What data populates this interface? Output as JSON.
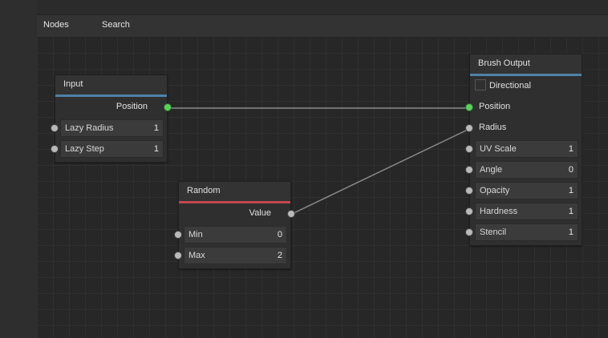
{
  "menu": {
    "nodes_label": "Nodes",
    "search_label": "Search"
  },
  "nodes": {
    "input": {
      "title": "Input",
      "output_label": "Position",
      "fields": [
        {
          "label": "Lazy Radius",
          "value": "1"
        },
        {
          "label": "Lazy Step",
          "value": "1"
        }
      ]
    },
    "random": {
      "title": "Random",
      "output_label": "Value",
      "fields": [
        {
          "label": "Min",
          "value": "0"
        },
        {
          "label": "Max",
          "value": "2"
        }
      ]
    },
    "brush_output": {
      "title": "Brush Output",
      "checkbox_label": "Directional",
      "position_label": "Position",
      "radius_label": "Radius",
      "fields": [
        {
          "label": "UV Scale",
          "value": "1"
        },
        {
          "label": "Angle",
          "value": "0"
        },
        {
          "label": "Opacity",
          "value": "1"
        },
        {
          "label": "Hardness",
          "value": "1"
        },
        {
          "label": "Stencil",
          "value": "1"
        }
      ]
    }
  },
  "colors": {
    "header_accent_blue": "#4f81a8",
    "header_accent_red": "#c2474f",
    "connected_port": "#5bd15b",
    "wire": "#8a8a8a"
  }
}
